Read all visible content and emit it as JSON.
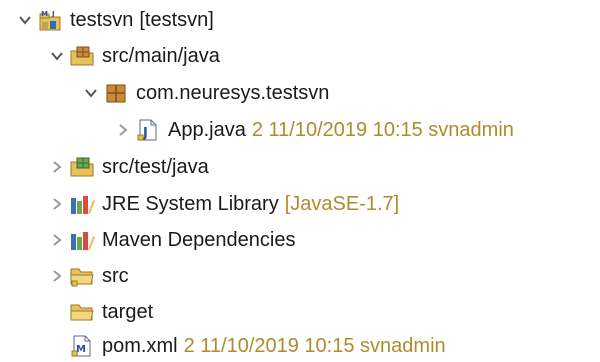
{
  "tree": {
    "project": {
      "label": "testsvn",
      "deco": "[testsvn]"
    },
    "src_main_java": {
      "label": "src/main/java"
    },
    "package": {
      "label": "com.neuresys.testsvn"
    },
    "app_java": {
      "label": "App.java",
      "deco": "2  11/10/2019 10:15  svnadmin"
    },
    "src_test_java": {
      "label": "src/test/java"
    },
    "jre": {
      "label": "JRE System Library",
      "deco": "[JavaSE-1.7]"
    },
    "maven": {
      "label": "Maven Dependencies"
    },
    "src": {
      "label": "src"
    },
    "target": {
      "label": "target"
    },
    "pom": {
      "label": "pom.xml",
      "deco": "2  11/10/2019 10:15  svnadmin"
    }
  },
  "colors": {
    "decoration": "#b08a2e",
    "arrow": "#555555",
    "folder": "#e8c15a"
  }
}
